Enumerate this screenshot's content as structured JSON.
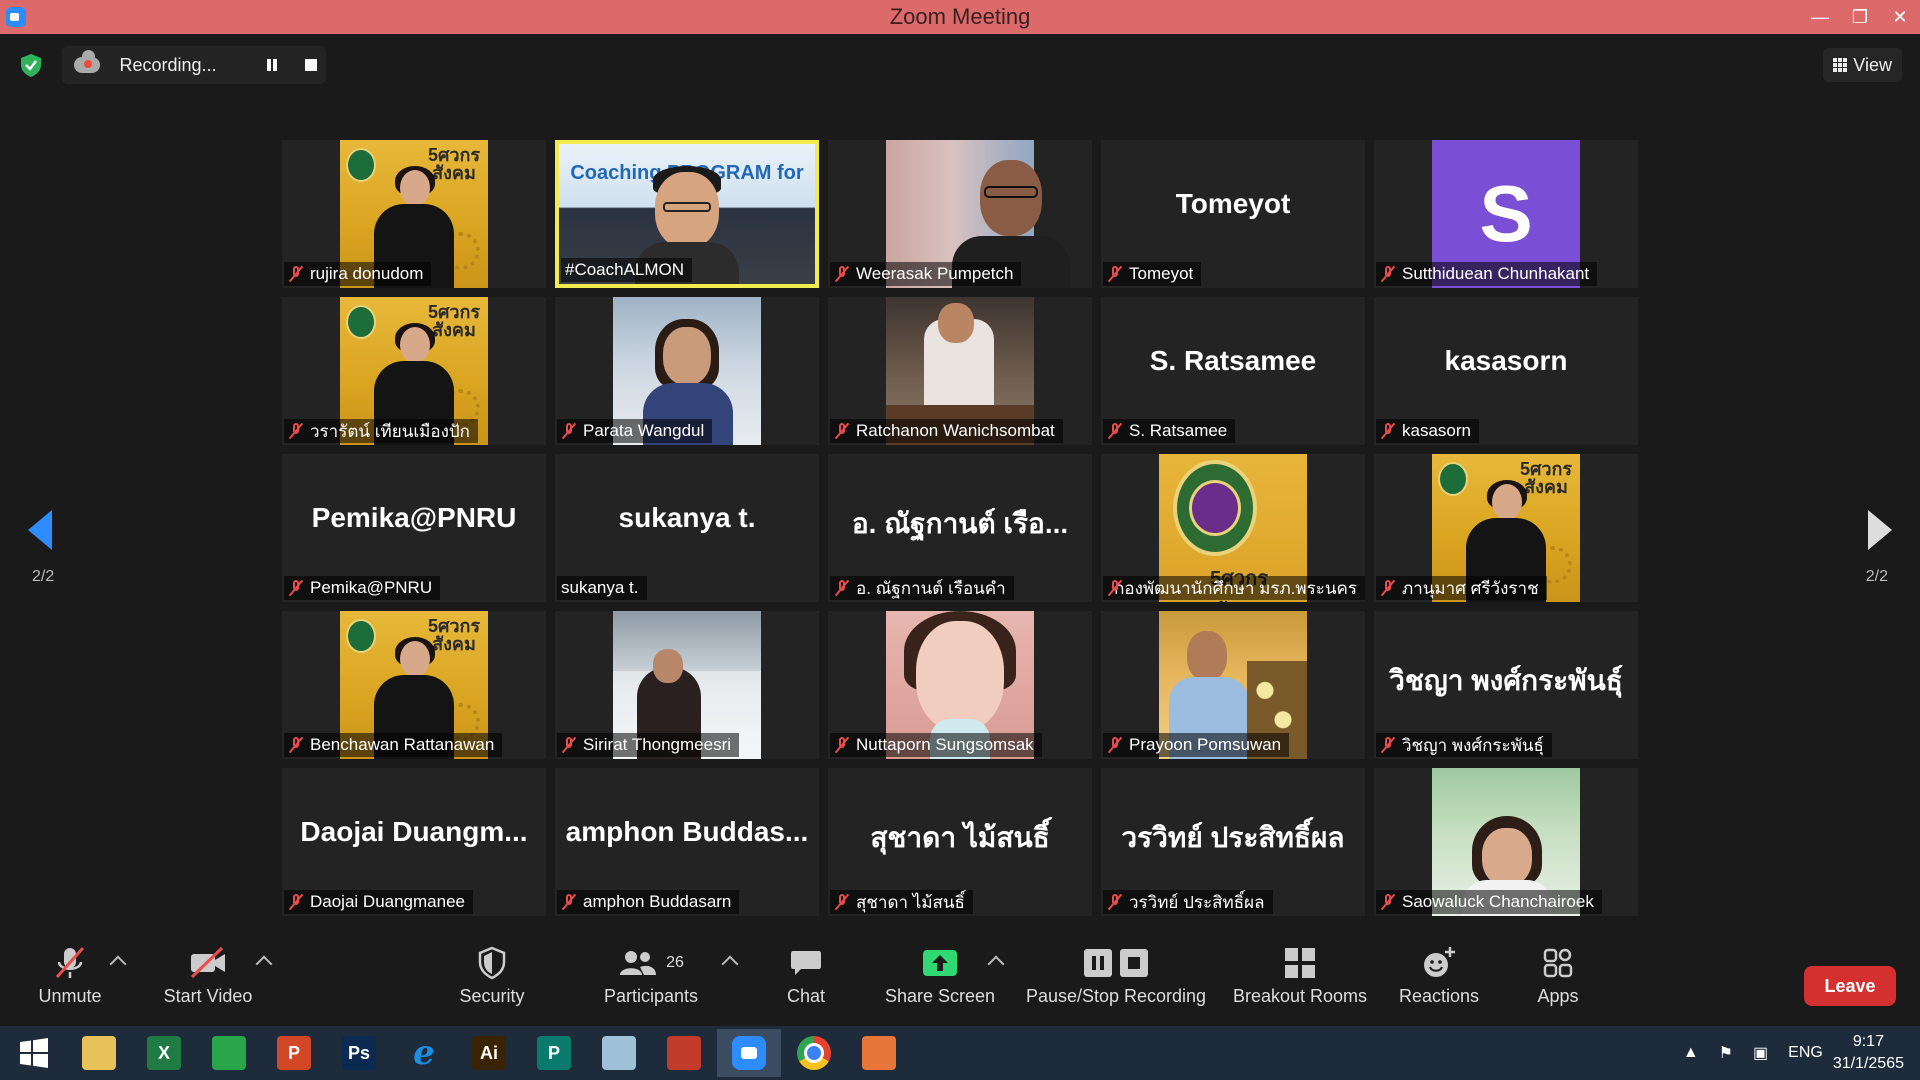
{
  "window": {
    "title": "Zoom Meeting",
    "minimize": "—",
    "restore": "❐",
    "close": "✕"
  },
  "recording": {
    "status": "Recording..."
  },
  "view_button": {
    "label": "View"
  },
  "pagination": {
    "left": "2/2",
    "right": "2/2"
  },
  "participants": [
    {
      "name": "rujira donudom",
      "muted": true,
      "tile": "photo",
      "photo": "yellow-portrait"
    },
    {
      "name": "#CoachALMON",
      "muted": false,
      "tile": "photo",
      "photo": "coach",
      "active": true,
      "banner": "Coaching PROGRAM for ...er"
    },
    {
      "name": "Weerasak Pumpetch",
      "muted": true,
      "tile": "photo",
      "photo": "room"
    },
    {
      "name": "Tomeyot",
      "muted": true,
      "tile": "text",
      "display": "Tomeyot"
    },
    {
      "name": "Sutthiduean Chunhakant",
      "muted": true,
      "tile": "letter",
      "letter": "S"
    },
    {
      "name": "วรารัตน์ เทียนเมืองปัก",
      "muted": true,
      "tile": "photo",
      "photo": "yellow-portrait"
    },
    {
      "name": "Parata Wangdul",
      "muted": true,
      "tile": "photo",
      "photo": "office"
    },
    {
      "name": "Ratchanon Wanichsombat",
      "muted": true,
      "tile": "photo",
      "photo": "food"
    },
    {
      "name": "S. Ratsamee",
      "muted": true,
      "tile": "text",
      "display": "S. Ratsamee"
    },
    {
      "name": "kasasorn",
      "muted": true,
      "tile": "text",
      "display": "kasasorn"
    },
    {
      "name": "Pemika@PNRU",
      "muted": true,
      "tile": "text",
      "display": "Pemika@PNRU"
    },
    {
      "name": "sukanya t.",
      "muted": false,
      "tile": "text",
      "display": "sukanya t."
    },
    {
      "name": "อ. ณัฐกานต์ เรือนคำ",
      "muted": true,
      "tile": "text",
      "display": "อ. ณัฐกานต์ เรือ..."
    },
    {
      "name": "กองพัฒนานักศึกษา มรภ.พระนคร",
      "muted": true,
      "tile": "photo",
      "photo": "seal"
    },
    {
      "name": "ภานุมาศ ศรีวังราช",
      "muted": true,
      "tile": "photo",
      "photo": "yellow-portrait"
    },
    {
      "name": "Benchawan Rattanawan",
      "muted": true,
      "tile": "photo",
      "photo": "yellow-portrait"
    },
    {
      "name": "Sirirat Thongmeesri",
      "muted": true,
      "tile": "photo",
      "photo": "snow"
    },
    {
      "name": "Nuttaporn Sungsomsak",
      "muted": true,
      "tile": "photo",
      "photo": "selfie"
    },
    {
      "name": "Prayoon Pomsuwan",
      "muted": true,
      "tile": "photo",
      "photo": "speaker"
    },
    {
      "name": "วิชญา พงศ์กระพันธุ์",
      "muted": true,
      "tile": "text",
      "display": "วิชญา พงศ์กระพันธุ์"
    },
    {
      "name": "Daojai Duangmanee",
      "muted": true,
      "tile": "text",
      "display": "Daojai Duangm..."
    },
    {
      "name": "amphon Buddasarn",
      "muted": true,
      "tile": "text",
      "display": "amphon Buddas..."
    },
    {
      "name": "สุชาดา ไม้สนธิ์",
      "muted": true,
      "tile": "text",
      "display": "สุชาดา ไม้สนธิ์"
    },
    {
      "name": "วรวิทย์ ประสิทธิ์ผล",
      "muted": true,
      "tile": "text",
      "display": "วรวิทย์ ประสิทธิ์ผล"
    },
    {
      "name": "Saowaluck Chanchairoek",
      "muted": true,
      "tile": "photo",
      "photo": "garden"
    }
  ],
  "toolbar": {
    "unmute": "Unmute",
    "start_video": "Start Video",
    "security": "Security",
    "participants": "Participants",
    "participants_count": "26",
    "chat": "Chat",
    "share_screen": "Share Screen",
    "pause_stop_recording": "Pause/Stop Recording",
    "breakout_rooms": "Breakout Rooms",
    "reactions": "Reactions",
    "apps": "Apps",
    "leave": "Leave"
  },
  "taskbar": {
    "apps": [
      {
        "name": "start-button",
        "color": "#ffffff",
        "text": ""
      },
      {
        "name": "file-explorer-icon",
        "color": "#e8c15a",
        "text": ""
      },
      {
        "name": "excel-icon",
        "color": "#1f7a43",
        "text": "X"
      },
      {
        "name": "store-icon",
        "color": "#2aa64a",
        "text": ""
      },
      {
        "name": "powerpoint-icon",
        "color": "#d24726",
        "text": "P"
      },
      {
        "name": "photoshop-icon",
        "color": "#0b2a52",
        "text": "Ps"
      },
      {
        "name": "internet-explorer-icon",
        "color": "#1b8fe3",
        "text": "e"
      },
      {
        "name": "illustrator-icon",
        "color": "#3a2300",
        "text": "Ai"
      },
      {
        "name": "publisher-icon",
        "color": "#0a7a6d",
        "text": "P"
      },
      {
        "name": "notepad-icon",
        "color": "#9fc1d8",
        "text": ""
      },
      {
        "name": "photoscape-icon",
        "color": "#c23a2a",
        "text": ""
      },
      {
        "name": "zoom-icon",
        "color": "#2d8cff",
        "text": ""
      },
      {
        "name": "chrome-icon",
        "color": "#e5432f",
        "text": ""
      },
      {
        "name": "app-icon",
        "color": "#e8753a",
        "text": ""
      }
    ],
    "language": "ENG",
    "time": "9:17",
    "date": "31/1/2565"
  },
  "colors": {
    "titlebar": "#dc6a6a",
    "active_speaker_border": "#f1ec4e",
    "share_green": "#2fd870",
    "leave_red": "#d43030",
    "accent_blue": "#2d8cff"
  }
}
